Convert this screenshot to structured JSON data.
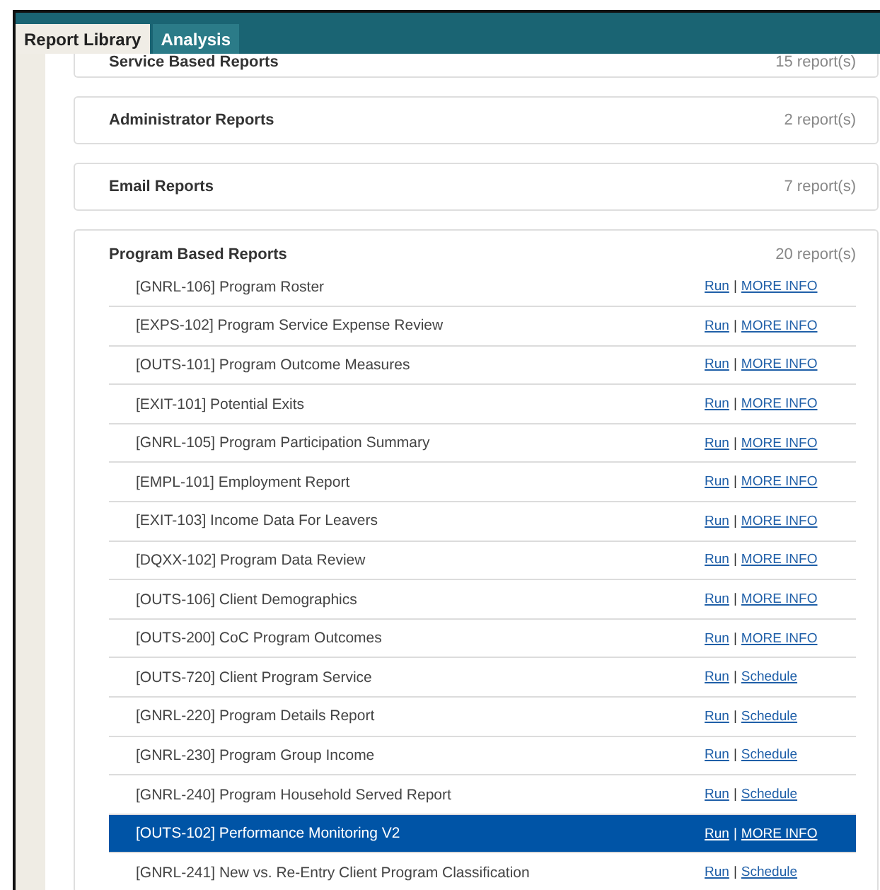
{
  "tabs": [
    {
      "label": "Report Library",
      "selected": true
    },
    {
      "label": "Analysis",
      "selected": false
    }
  ],
  "sections": [
    {
      "title": "Service Based Reports",
      "count": "15 report(s)"
    },
    {
      "title": "Administrator Reports",
      "count": "2 report(s)"
    },
    {
      "title": "Email Reports",
      "count": "7 report(s)"
    }
  ],
  "program_section": {
    "title": "Program Based Reports",
    "count": "20 report(s)",
    "rows": [
      {
        "label": "[GNRL-106] Program Roster",
        "run": "Run",
        "sep": "|",
        "link": "MORE INFO",
        "selected": false
      },
      {
        "label": "[EXPS-102] Program Service Expense Review",
        "run": "Run",
        "sep": "|",
        "link": "MORE INFO",
        "selected": false
      },
      {
        "label": "[OUTS-101] Program Outcome Measures",
        "run": "Run",
        "sep": "|",
        "link": "MORE INFO",
        "selected": false
      },
      {
        "label": "[EXIT-101] Potential Exits",
        "run": "Run",
        "sep": "|",
        "link": "MORE INFO",
        "selected": false
      },
      {
        "label": "[GNRL-105] Program Participation Summary",
        "run": "Run",
        "sep": "|",
        "link": "MORE INFO",
        "selected": false
      },
      {
        "label": "[EMPL-101] Employment Report",
        "run": "Run",
        "sep": "|",
        "link": "MORE INFO",
        "selected": false
      },
      {
        "label": "[EXIT-103] Income Data For Leavers",
        "run": "Run",
        "sep": "|",
        "link": "MORE INFO",
        "selected": false
      },
      {
        "label": "[DQXX-102] Program Data Review",
        "run": "Run",
        "sep": "|",
        "link": "MORE INFO",
        "selected": false
      },
      {
        "label": "[OUTS-106] Client Demographics",
        "run": "Run",
        "sep": "|",
        "link": "MORE INFO",
        "selected": false
      },
      {
        "label": "[OUTS-200] CoC Program Outcomes",
        "run": "Run",
        "sep": "|",
        "link": "MORE INFO",
        "selected": false
      },
      {
        "label": "[OUTS-720] Client Program Service",
        "run": "Run",
        "sep": "|",
        "link": "Schedule",
        "selected": false
      },
      {
        "label": "[GNRL-220] Program Details Report",
        "run": "Run",
        "sep": "|",
        "link": "Schedule",
        "selected": false
      },
      {
        "label": "[GNRL-230] Program Group Income",
        "run": "Run",
        "sep": "|",
        "link": "Schedule",
        "selected": false
      },
      {
        "label": "[GNRL-240] Program Household Served Report",
        "run": "Run",
        "sep": "|",
        "link": "Schedule",
        "selected": false
      },
      {
        "label": "[OUTS-102] Performance Monitoring V2",
        "run": "Run",
        "sep": "|",
        "link": "MORE INFO",
        "selected": true
      },
      {
        "label": "[GNRL-241] New vs. Re-Entry Client Program Classification",
        "run": "Run",
        "sep": "|",
        "link": "Schedule",
        "selected": false
      }
    ]
  }
}
